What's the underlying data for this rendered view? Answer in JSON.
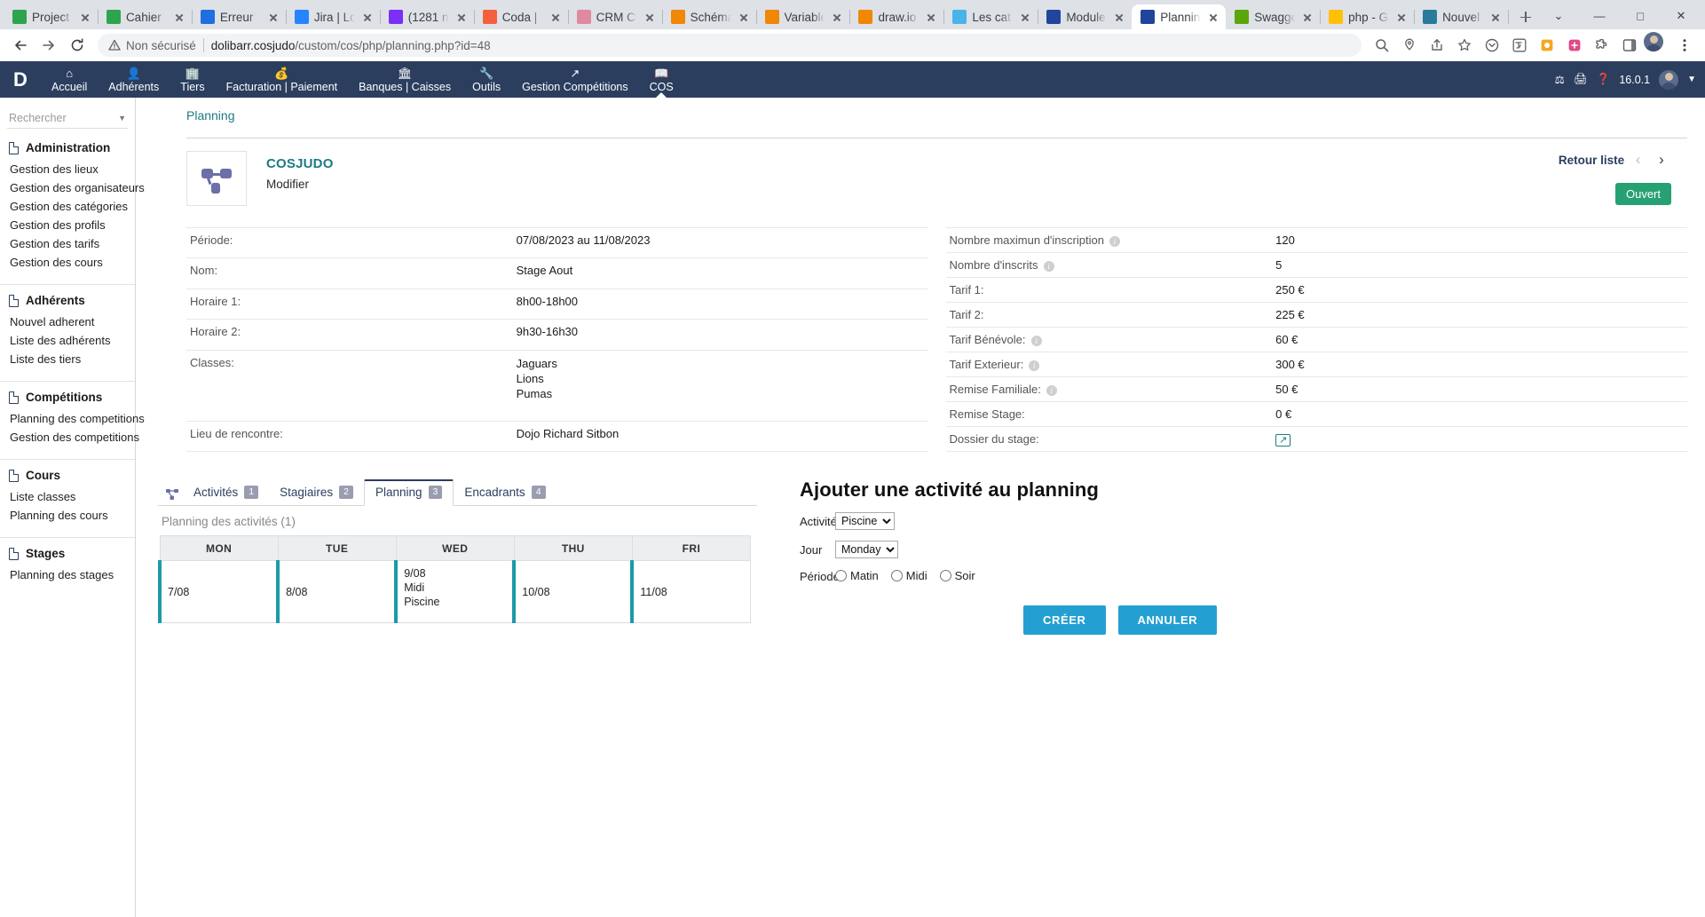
{
  "browser": {
    "tabs": [
      {
        "title": "Project",
        "favicon": "trello-green-icon",
        "color": "#2ea44f",
        "active": false
      },
      {
        "title": "Cahier",
        "favicon": "trello-green-icon",
        "color": "#2ea44f",
        "active": false
      },
      {
        "title": "Erreur",
        "favicon": "trello-blue-icon",
        "color": "#1f6fe0",
        "active": false
      },
      {
        "title": "Jira | Lo",
        "favicon": "jira-icon",
        "color": "#2684ff",
        "active": false
      },
      {
        "title": "(1281 n",
        "favicon": "mail-icon",
        "color": "#7b2ff7",
        "active": false
      },
      {
        "title": "Coda |",
        "favicon": "coda-icon",
        "color": "#f4603e",
        "active": false
      },
      {
        "title": "CRM C",
        "favicon": "crm-icon",
        "color": "#e08aa0",
        "active": false
      },
      {
        "title": "Schéma",
        "favicon": "drawio-icon",
        "color": "#f08705",
        "active": false
      },
      {
        "title": "Variable",
        "favicon": "drawio-icon",
        "color": "#f08705",
        "active": false
      },
      {
        "title": "draw.io",
        "favicon": "drawio-icon",
        "color": "#f08705",
        "active": false
      },
      {
        "title": "Les cat",
        "favicon": "pencil-icon",
        "color": "#4ab3e8",
        "active": false
      },
      {
        "title": "Module",
        "favicon": "dolibarr-icon",
        "color": "#21459c",
        "active": false
      },
      {
        "title": "Planning",
        "favicon": "dolibarr-icon",
        "color": "#21459c",
        "active": true
      },
      {
        "title": "Swagge",
        "favicon": "swagger-icon",
        "color": "#5aa60b",
        "active": false
      },
      {
        "title": "php - G",
        "favicon": "drive-icon",
        "color": "#ffc107",
        "active": false
      },
      {
        "title": "Nouvel",
        "favicon": "sheet-icon",
        "color": "#2a7b9b",
        "active": false
      }
    ],
    "new_tab_label": "+",
    "window_controls": [
      "minimize",
      "maximize",
      "close"
    ],
    "security_label": "Non sécurisé",
    "url_host": "dolibarr.cosjudo",
    "url_path": "/custom/cos/php/planning.php?id=48",
    "nav": {
      "back": "back-icon",
      "forward": "forward-icon",
      "reload": "reload-icon"
    }
  },
  "appbar": {
    "logo": "D",
    "menu": [
      {
        "label": "Accueil",
        "icon": "home-icon",
        "active": false
      },
      {
        "label": "Adhérents",
        "icon": "user-icon",
        "active": false
      },
      {
        "label": "Tiers",
        "icon": "building-icon",
        "active": false
      },
      {
        "label": "Facturation | Paiement",
        "icon": "coins-icon",
        "active": false
      },
      {
        "label": "Banques | Caisses",
        "icon": "bank-icon",
        "active": false
      },
      {
        "label": "Outils",
        "icon": "wrench-icon",
        "active": false
      },
      {
        "label": "Gestion Compétitions",
        "icon": "arrow-out-icon",
        "active": false
      },
      {
        "label": "COS",
        "icon": "book-icon",
        "active": true
      }
    ],
    "version": "16.0.1",
    "right_icons": [
      "tools-icon",
      "print-icon",
      "help-icon"
    ]
  },
  "sidebar": {
    "search_placeholder": "Rechercher",
    "groups": [
      {
        "title": "Administration",
        "items": [
          "Gestion des lieux",
          "Gestion des organisateurs",
          "Gestion des catégories",
          "Gestion des profils",
          "Gestion des tarifs",
          "Gestion des cours"
        ]
      },
      {
        "title": "Adhérents",
        "items": [
          "Nouvel adherent",
          "Liste des adhérents",
          "Liste des tiers"
        ]
      },
      {
        "title": "Compétitions",
        "items": [
          "Planning des competitions",
          "Gestion des competitions"
        ]
      },
      {
        "title": "Cours",
        "items": [
          "Liste classes",
          "Planning des cours"
        ]
      },
      {
        "title": "Stages",
        "items": [
          "Planning des stages"
        ]
      }
    ]
  },
  "main": {
    "breadcrumb": "Planning",
    "object": {
      "title": "COSJUDO",
      "subtitle": "Modifier",
      "thumb_icon": "org-chart-icon"
    },
    "header_actions": {
      "back_to_list": "Retour liste",
      "prev": "‹",
      "next": "›",
      "status_badge": "Ouvert",
      "status_color": "#27a074"
    },
    "left_table": [
      {
        "label": "Période:",
        "value": "07/08/2023 au 11/08/2023"
      },
      {
        "label": "Nom:",
        "value": "Stage Aout"
      },
      {
        "label": "Horaire 1:",
        "value": "8h00-18h00"
      },
      {
        "label": "Horaire 2:",
        "value": "9h30-16h30"
      },
      {
        "label": "Classes:",
        "values": [
          "Jaguars",
          "Lions",
          "Pumas"
        ]
      },
      {
        "label": "Lieu de rencontre:",
        "value": "Dojo Richard Sitbon"
      }
    ],
    "right_table": [
      {
        "label": "Nombre maximun d'inscription",
        "info": true,
        "value": "120"
      },
      {
        "label": "Nombre d'inscrits",
        "info": true,
        "value": "5"
      },
      {
        "label": "Tarif 1:",
        "info": false,
        "value": "250 €"
      },
      {
        "label": "Tarif 2:",
        "info": false,
        "value": "225 €"
      },
      {
        "label": "Tarif Bénévole:",
        "info": true,
        "value": "60 €"
      },
      {
        "label": "Tarif Exterieur:",
        "info": true,
        "value": "300 €"
      },
      {
        "label": "Remise Familiale:",
        "info": true,
        "value": "50 €"
      },
      {
        "label": "Remise Stage:",
        "info": false,
        "value": "0 €"
      },
      {
        "label": "Dossier du stage:",
        "info": false,
        "value": "",
        "icon": "external-link-icon"
      }
    ],
    "tabs": [
      {
        "label": "Activités",
        "badge": "1",
        "active": false
      },
      {
        "label": "Stagiaires",
        "badge": "2",
        "active": false
      },
      {
        "label": "Planning",
        "badge": "3",
        "active": true
      },
      {
        "label": "Encadrants",
        "badge": "4",
        "active": false
      }
    ],
    "planning": {
      "title": "Planning des activités",
      "count": "(1)",
      "columns": [
        "MON",
        "TUE",
        "WED",
        "THU",
        "FRI"
      ],
      "cells": [
        {
          "date": "7/08",
          "lines": []
        },
        {
          "date": "8/08",
          "lines": []
        },
        {
          "date": "9/08",
          "lines": [
            "Midi",
            "Piscine"
          ]
        },
        {
          "date": "10/08",
          "lines": []
        },
        {
          "date": "11/08",
          "lines": []
        }
      ]
    },
    "form": {
      "title": "Ajouter une activité au planning",
      "activity_label": "Activité",
      "activity_value": "Piscine",
      "activity_options": [
        "Piscine"
      ],
      "day_label": "Jour",
      "day_value": "Monday",
      "day_options": [
        "Monday"
      ],
      "period_label": "Période",
      "period_options": [
        {
          "label": "Matin",
          "checked": false
        },
        {
          "label": "Midi",
          "checked": false
        },
        {
          "label": "Soir",
          "checked": false
        }
      ],
      "submit_label": "CRÉER",
      "cancel_label": "ANNULER",
      "button_color": "#23a0d1"
    }
  }
}
